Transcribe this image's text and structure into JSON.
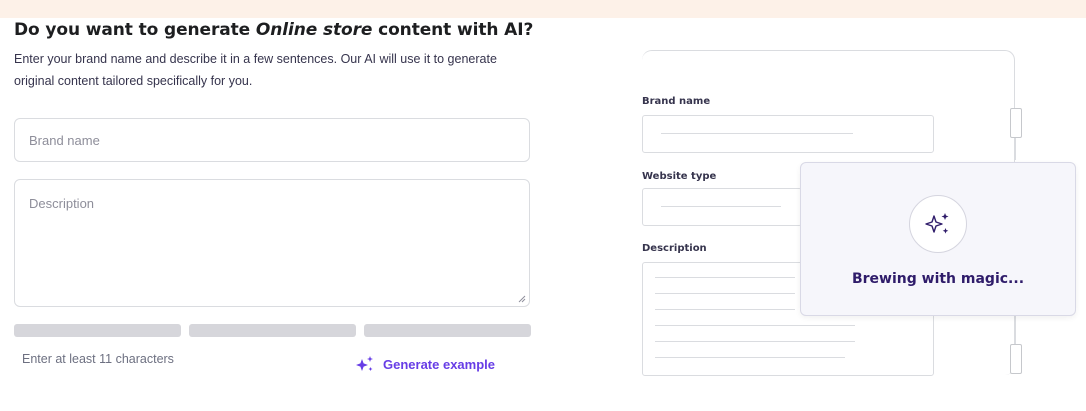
{
  "heading": {
    "prefix": "Do you want to generate ",
    "emphasis": "Online store",
    "suffix": " content with AI?"
  },
  "subtitle": "Enter your brand name and describe it in a few sentences. Our AI will use it to generate original content tailored specifically for you.",
  "form": {
    "brand_placeholder": "Brand name",
    "description_placeholder": "Description",
    "hint": "Enter at least 11 characters",
    "generate_example_label": "Generate example",
    "strength_bars": 3
  },
  "illustration": {
    "brand_label": "Brand name",
    "website_type_label": "Website type",
    "description_label": "Description",
    "status_text": "Brewing with magic..."
  },
  "colors": {
    "accent": "#673de6",
    "background": "#fdf1e8",
    "popup_bg": "#f6f6fb"
  }
}
